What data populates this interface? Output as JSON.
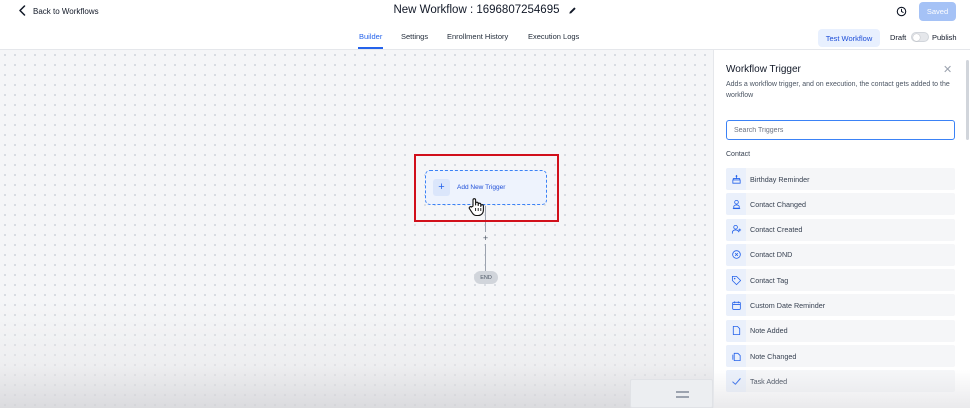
{
  "header": {
    "back_label": "Back to Workflows",
    "title": "New Workflow : 1696807254695",
    "saved_label": "Saved"
  },
  "tabs": [
    {
      "label": "Builder",
      "active": true
    },
    {
      "label": "Settings",
      "active": false
    },
    {
      "label": "Enrollment History",
      "active": false
    },
    {
      "label": "Execution Logs",
      "active": false
    }
  ],
  "toolbar": {
    "test_label": "Test Workflow",
    "draft_label": "Draft",
    "publish_label": "Publish",
    "published": false
  },
  "canvas": {
    "trigger_label": "Add New Trigger",
    "add_step_symbol": "+",
    "end_label": "END"
  },
  "panel": {
    "title": "Workflow Trigger",
    "description": "Adds a workflow trigger, and on execution, the contact gets added to the workflow",
    "search_placeholder": "Search Triggers",
    "section": "Contact",
    "items": [
      {
        "label": "Birthday Reminder",
        "icon": "cake-icon"
      },
      {
        "label": "Contact Changed",
        "icon": "contacts-changed-icon"
      },
      {
        "label": "Contact Created",
        "icon": "user-add-icon"
      },
      {
        "label": "Contact DND",
        "icon": "dnd-icon"
      },
      {
        "label": "Contact Tag",
        "icon": "tag-icon"
      },
      {
        "label": "Custom Date Reminder",
        "icon": "calendar-icon"
      },
      {
        "label": "Note Added",
        "icon": "note-icon"
      },
      {
        "label": "Note Changed",
        "icon": "note-changed-icon"
      },
      {
        "label": "Task Added",
        "icon": "check-icon"
      }
    ]
  },
  "colors": {
    "accent": "#2563eb",
    "highlight": "#d1101b",
    "saved_button": "#a5c2f6"
  }
}
